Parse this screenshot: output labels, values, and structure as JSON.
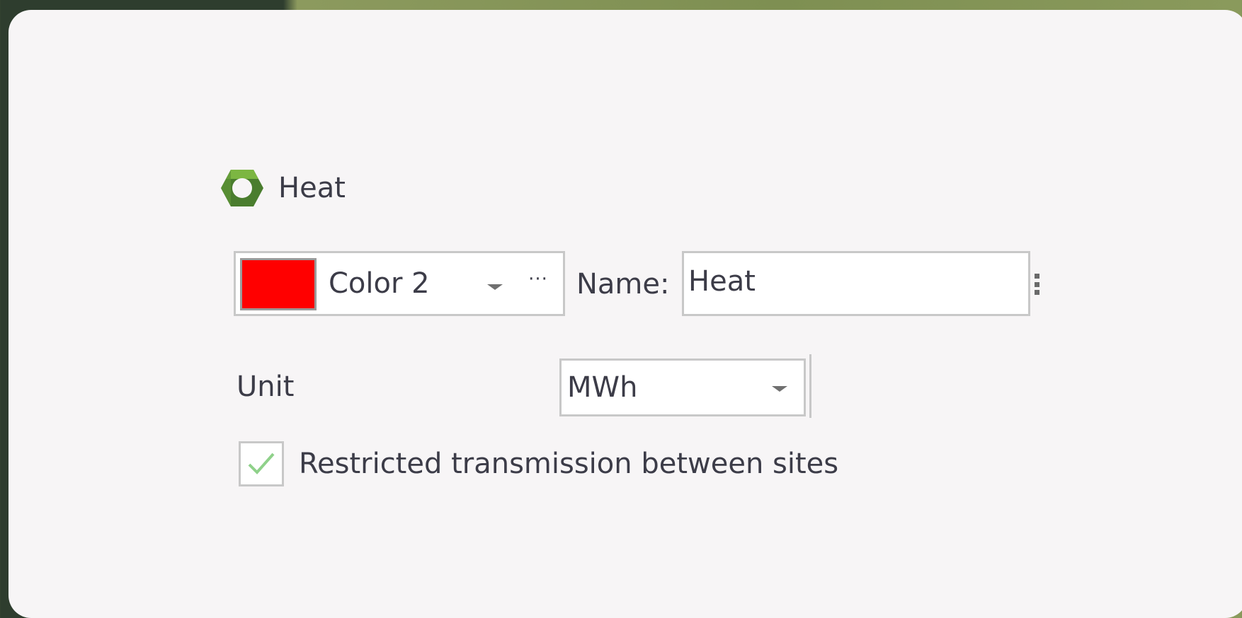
{
  "header": {
    "icon": "hexagon-nut-icon",
    "title": "Heat",
    "colors": {
      "icon_light": "#6ea83c",
      "icon_dark": "#2f5a22"
    }
  },
  "color_picker": {
    "swatch_color": "#ff0000",
    "value": "Color 2",
    "dropdown_icon": "chevron-down-icon",
    "more_label": "···"
  },
  "name": {
    "label": "Name:",
    "value": "Heat"
  },
  "unit": {
    "label": "Unit",
    "value": "MWh",
    "dropdown_icon": "chevron-down-icon"
  },
  "restricted": {
    "label": "Restricted transmission between sites",
    "checked": true,
    "check_color": "#8fd18a"
  }
}
